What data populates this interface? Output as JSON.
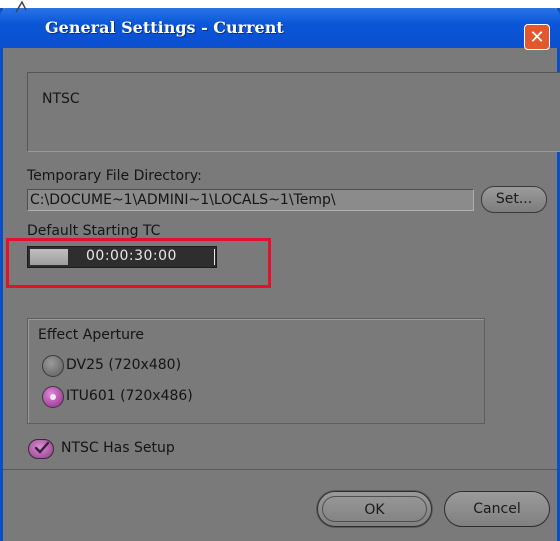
{
  "window": {
    "title": "General Settings - Current",
    "close_glyph": "✕"
  },
  "preset": {
    "value": "NTSC"
  },
  "temp_dir": {
    "label": "Temporary File Directory:",
    "value": "C:\\DOCUME~1\\ADMINI~1\\LOCALS~1\\Temp\\",
    "set_button": "Set..."
  },
  "starting_tc": {
    "label": "Default Starting TC",
    "value": "00:00:30:00"
  },
  "effect_aperture": {
    "label": "Effect Aperture",
    "options": [
      {
        "label": "DV25 (720x480)",
        "selected": false
      },
      {
        "label": "ITU601 (720x486)",
        "selected": true
      }
    ]
  },
  "ntsc_setup": {
    "label": "NTSC Has Setup",
    "checked": true
  },
  "buttons": {
    "ok": "OK",
    "cancel": "Cancel"
  },
  "colors": {
    "title_bar": "#0a56d8",
    "dialog_bg": "#7a7a7a",
    "highlight": "#e2122b",
    "accent_purple": "#b04aa8"
  },
  "icons": {
    "close": "close-icon",
    "check": "check-icon",
    "radio": "radio-icon"
  }
}
